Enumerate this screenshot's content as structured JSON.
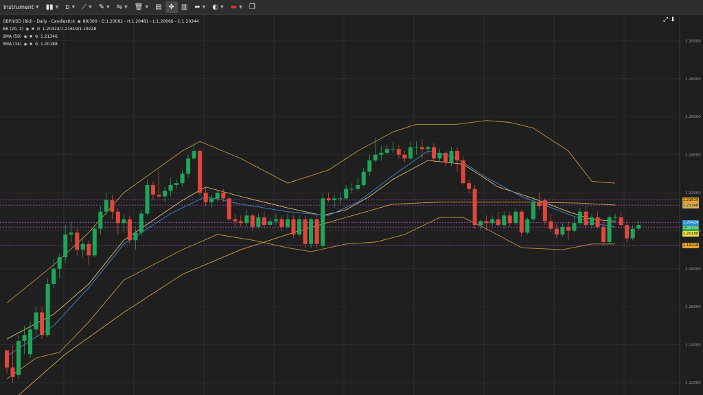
{
  "toolbar": {
    "instrument_label": "Instrument",
    "timeframe_label": "D",
    "items": [
      {
        "name": "candle-type-icon"
      },
      {
        "name": "timeframe"
      },
      {
        "name": "draw-line-icon"
      },
      {
        "name": "ruler-icon"
      },
      {
        "name": "trend-tools-icon"
      },
      {
        "name": "trash-icon"
      },
      {
        "name": "layout-icon"
      },
      {
        "name": "crosshair-icon"
      },
      {
        "name": "chart-type-icon"
      },
      {
        "name": "share-icon"
      },
      {
        "name": "theme-icon"
      },
      {
        "name": "flag-uk-icon"
      },
      {
        "name": "popout-icon"
      }
    ]
  },
  "legend": {
    "title": "GBP/USD (Bid) - Daily - Candlestick",
    "ohlc": "89/300 - O:1.20092 - H:1.20481 - L:1.20066 - C:1.20344",
    "bb_name": "BB (20, 2)",
    "bb_values": "1.20424/1.21619/1.19228",
    "sma50_name": "SMA (50)",
    "sma50_value": "1.21346",
    "sma14_name": "SMA (14)",
    "sma14_value": "1.20188"
  },
  "chart_data": {
    "type": "candlestick",
    "y_ticks": [
      1.12,
      1.14,
      1.16,
      1.18,
      1.2,
      1.22,
      1.24,
      1.26,
      1.28,
      1.3
    ],
    "ylim": [
      1.1135,
      1.3135
    ],
    "price_tags": [
      {
        "label": "1.21619",
        "value": 1.21619,
        "color": "#e5a52a",
        "text_color": "#111111"
      },
      {
        "label": "1.21346",
        "value": 1.21346,
        "color": "#d8b25a",
        "text_color": "#111111"
      },
      {
        "label": "1.20424",
        "value": 1.20424,
        "color": "#2a8fd6",
        "text_color": "#ffffff"
      },
      {
        "label": "1.20344",
        "value": 1.20344,
        "color": "#2aa84f",
        "text_color": "#ffffff"
      },
      {
        "label": "1.20188",
        "value": 1.20188,
        "color": "#f0e04a",
        "text_color": "#111111"
      },
      {
        "label": "1.19228",
        "value": 1.19228,
        "color": "#e5a52a",
        "text_color": "#111111"
      }
    ],
    "hlines": [
      1.21619,
      1.21346,
      1.20424,
      1.20188,
      1.19228
    ],
    "candles": [
      [
        1.137,
        1.128,
        1.135,
        1.125
      ],
      [
        1.128,
        1.123,
        1.14,
        1.12
      ],
      [
        1.124,
        1.142,
        1.145,
        1.122
      ],
      [
        1.142,
        1.145,
        1.15,
        1.135
      ],
      [
        1.135,
        1.148,
        1.152,
        1.133
      ],
      [
        1.148,
        1.157,
        1.16,
        1.145
      ],
      [
        1.157,
        1.145,
        1.16,
        1.143
      ],
      [
        1.145,
        1.172,
        1.175,
        1.144
      ],
      [
        1.172,
        1.18,
        1.185,
        1.17
      ],
      [
        1.18,
        1.186,
        1.188,
        1.175
      ],
      [
        1.186,
        1.198,
        1.203,
        1.183
      ],
      [
        1.198,
        1.199,
        1.205,
        1.194
      ],
      [
        1.199,
        1.19,
        1.201,
        1.187
      ],
      [
        1.19,
        1.193,
        1.196,
        1.186
      ],
      [
        1.193,
        1.187,
        1.195,
        1.182
      ],
      [
        1.187,
        1.201,
        1.203,
        1.186
      ],
      [
        1.201,
        1.21,
        1.213,
        1.198
      ],
      [
        1.21,
        1.216,
        1.22,
        1.208
      ],
      [
        1.216,
        1.21,
        1.219,
        1.206
      ],
      [
        1.21,
        1.204,
        1.212,
        1.198
      ],
      [
        1.204,
        1.206,
        1.209,
        1.199
      ],
      [
        1.206,
        1.195,
        1.208,
        1.193
      ],
      [
        1.195,
        1.199,
        1.201,
        1.19
      ],
      [
        1.199,
        1.209,
        1.211,
        1.197
      ],
      [
        1.209,
        1.224,
        1.227,
        1.208
      ],
      [
        1.224,
        1.219,
        1.226,
        1.216
      ],
      [
        1.219,
        1.218,
        1.232,
        1.217
      ],
      [
        1.218,
        1.221,
        1.223,
        1.215
      ],
      [
        1.221,
        1.224,
        1.228,
        1.218
      ],
      [
        1.224,
        1.225,
        1.227,
        1.222
      ],
      [
        1.225,
        1.23,
        1.232,
        1.223
      ],
      [
        1.23,
        1.238,
        1.24,
        1.228
      ],
      [
        1.238,
        1.242,
        1.246,
        1.237
      ],
      [
        1.242,
        1.22,
        1.243,
        1.218
      ],
      [
        1.22,
        1.215,
        1.223,
        1.213
      ],
      [
        1.215,
        1.217,
        1.219,
        1.212
      ],
      [
        1.217,
        1.22,
        1.221,
        1.215
      ],
      [
        1.22,
        1.217,
        1.222,
        1.215
      ],
      [
        1.217,
        1.206,
        1.218,
        1.205
      ],
      [
        1.206,
        1.205,
        1.209,
        1.202
      ],
      [
        1.205,
        1.204,
        1.208,
        1.202
      ],
      [
        1.204,
        1.208,
        1.211,
        1.202
      ],
      [
        1.208,
        1.202,
        1.209,
        1.2
      ],
      [
        1.202,
        1.207,
        1.209,
        1.201
      ],
      [
        1.207,
        1.203,
        1.21,
        1.201
      ],
      [
        1.203,
        1.205,
        1.207,
        1.203
      ],
      [
        1.205,
        1.206,
        1.209,
        1.203
      ],
      [
        1.206,
        1.202,
        1.208,
        1.2
      ],
      [
        1.202,
        1.206,
        1.209,
        1.201
      ],
      [
        1.206,
        1.198,
        1.208,
        1.196
      ],
      [
        1.198,
        1.206,
        1.208,
        1.197
      ],
      [
        1.206,
        1.193,
        1.208,
        1.191
      ],
      [
        1.193,
        1.206,
        1.207,
        1.191
      ],
      [
        1.206,
        1.193,
        1.208,
        1.191
      ],
      [
        1.192,
        1.217,
        1.22,
        1.191
      ],
      [
        1.217,
        1.216,
        1.22,
        1.215
      ],
      [
        1.216,
        1.217,
        1.219,
        1.212
      ],
      [
        1.217,
        1.217,
        1.22,
        1.214
      ],
      [
        1.217,
        1.222,
        1.224,
        1.216
      ],
      [
        1.222,
        1.222,
        1.225,
        1.22
      ],
      [
        1.222,
        1.224,
        1.228,
        1.221
      ],
      [
        1.224,
        1.231,
        1.233,
        1.223
      ],
      [
        1.231,
        1.237,
        1.24,
        1.229
      ],
      [
        1.237,
        1.24,
        1.249,
        1.236
      ],
      [
        1.24,
        1.241,
        1.245,
        1.237
      ],
      [
        1.241,
        1.243,
        1.245,
        1.24
      ],
      [
        1.243,
        1.243,
        1.247,
        1.241
      ],
      [
        1.243,
        1.24,
        1.245,
        1.238
      ],
      [
        1.24,
        1.238,
        1.242,
        1.236
      ],
      [
        1.238,
        1.244,
        1.247,
        1.237
      ],
      [
        1.244,
        1.244,
        1.247,
        1.24
      ],
      [
        1.244,
        1.243,
        1.248,
        1.238
      ],
      [
        1.243,
        1.244,
        1.245,
        1.24
      ],
      [
        1.244,
        1.238,
        1.246,
        1.236
      ],
      [
        1.238,
        1.241,
        1.243,
        1.236
      ],
      [
        1.241,
        1.236,
        1.242,
        1.234
      ],
      [
        1.236,
        1.242,
        1.244,
        1.234
      ],
      [
        1.242,
        1.237,
        1.244,
        1.231
      ],
      [
        1.237,
        1.225,
        1.239,
        1.224
      ],
      [
        1.225,
        1.222,
        1.227,
        1.22
      ],
      [
        1.222,
        1.203,
        1.224,
        1.201
      ],
      [
        1.203,
        1.205,
        1.206,
        1.2
      ],
      [
        1.205,
        1.204,
        1.208,
        1.2
      ],
      [
        1.204,
        1.206,
        1.208,
        1.202
      ],
      [
        1.206,
        1.203,
        1.21,
        1.202
      ],
      [
        1.203,
        1.208,
        1.21,
        1.201
      ],
      [
        1.208,
        1.204,
        1.21,
        1.202
      ],
      [
        1.204,
        1.21,
        1.212,
        1.203
      ],
      [
        1.21,
        1.199,
        1.211,
        1.197
      ],
      [
        1.199,
        1.206,
        1.207,
        1.198
      ],
      [
        1.206,
        1.215,
        1.218,
        1.204
      ],
      [
        1.215,
        1.213,
        1.22,
        1.211
      ],
      [
        1.216,
        1.205,
        1.217,
        1.203
      ],
      [
        1.205,
        1.201,
        1.209,
        1.199
      ],
      [
        1.201,
        1.198,
        1.204,
        1.196
      ],
      [
        1.198,
        1.202,
        1.204,
        1.197
      ],
      [
        1.202,
        1.2,
        1.205,
        1.195
      ],
      [
        1.2,
        1.204,
        1.207,
        1.199
      ],
      [
        1.204,
        1.21,
        1.212,
        1.203
      ],
      [
        1.21,
        1.203,
        1.213,
        1.201
      ],
      [
        1.203,
        1.207,
        1.209,
        1.201
      ],
      [
        1.207,
        1.202,
        1.21,
        1.201
      ],
      [
        1.202,
        1.194,
        1.205,
        1.192
      ],
      [
        1.194,
        1.207,
        1.208,
        1.193
      ],
      [
        1.207,
        1.207,
        1.209,
        1.204
      ],
      [
        1.207,
        1.203,
        1.21,
        1.201
      ],
      [
        1.203,
        1.196,
        1.205,
        1.194
      ],
      [
        1.196,
        1.201,
        1.203,
        1.195
      ],
      [
        1.201,
        1.203,
        1.205,
        1.2
      ]
    ],
    "bb_upper": [
      [
        0,
        1.162
      ],
      [
        8,
        1.182
      ],
      [
        14,
        1.199
      ],
      [
        20,
        1.22
      ],
      [
        30,
        1.242
      ],
      [
        33,
        1.247
      ],
      [
        40,
        1.238
      ],
      [
        48,
        1.225
      ],
      [
        55,
        1.232
      ],
      [
        60,
        1.242
      ],
      [
        66,
        1.252
      ],
      [
        70,
        1.256
      ],
      [
        77,
        1.256
      ],
      [
        82,
        1.258
      ],
      [
        86,
        1.257
      ],
      [
        90,
        1.254
      ],
      [
        96,
        1.242
      ],
      [
        100,
        1.226
      ],
      [
        104,
        1.225
      ]
    ],
    "bb_mid": [
      [
        0,
        1.143
      ],
      [
        8,
        1.156
      ],
      [
        14,
        1.172
      ],
      [
        20,
        1.195
      ],
      [
        30,
        1.216
      ],
      [
        34,
        1.223
      ],
      [
        40,
        1.218
      ],
      [
        48,
        1.212
      ],
      [
        54,
        1.208
      ],
      [
        58,
        1.211
      ],
      [
        62,
        1.218
      ],
      [
        66,
        1.227
      ],
      [
        72,
        1.237
      ],
      [
        78,
        1.235
      ],
      [
        84,
        1.223
      ],
      [
        90,
        1.217
      ],
      [
        96,
        1.21
      ],
      [
        100,
        1.206
      ],
      [
        104,
        1.205
      ]
    ],
    "bb_lower": [
      [
        0,
        1.122
      ],
      [
        5,
        1.133
      ],
      [
        9,
        1.136
      ],
      [
        14,
        1.152
      ],
      [
        20,
        1.174
      ],
      [
        30,
        1.19
      ],
      [
        36,
        1.198
      ],
      [
        42,
        1.195
      ],
      [
        48,
        1.191
      ],
      [
        52,
        1.189
      ],
      [
        58,
        1.193
      ],
      [
        63,
        1.194
      ],
      [
        68,
        1.198
      ],
      [
        74,
        1.207
      ],
      [
        78,
        1.207
      ],
      [
        82,
        1.201
      ],
      [
        88,
        1.191
      ],
      [
        95,
        1.19
      ],
      [
        100,
        1.193
      ],
      [
        104,
        1.193
      ]
    ],
    "sma50": [
      [
        0,
        1.108
      ],
      [
        10,
        1.135
      ],
      [
        20,
        1.157
      ],
      [
        30,
        1.177
      ],
      [
        40,
        1.19
      ],
      [
        50,
        1.2
      ],
      [
        58,
        1.207
      ],
      [
        66,
        1.214
      ],
      [
        74,
        1.215
      ],
      [
        82,
        1.215
      ],
      [
        90,
        1.215
      ],
      [
        98,
        1.2145
      ],
      [
        104,
        1.2135
      ]
    ],
    "sma14": [
      [
        0,
        1.134
      ],
      [
        8,
        1.15
      ],
      [
        14,
        1.17
      ],
      [
        20,
        1.193
      ],
      [
        28,
        1.209
      ],
      [
        34,
        1.218
      ],
      [
        40,
        1.214
      ],
      [
        48,
        1.21
      ],
      [
        55,
        1.208
      ],
      [
        60,
        1.215
      ],
      [
        66,
        1.229
      ],
      [
        72,
        1.242
      ],
      [
        77,
        1.238
      ],
      [
        82,
        1.228
      ],
      [
        88,
        1.218
      ],
      [
        94,
        1.211
      ],
      [
        100,
        1.204
      ],
      [
        104,
        1.202
      ]
    ]
  }
}
